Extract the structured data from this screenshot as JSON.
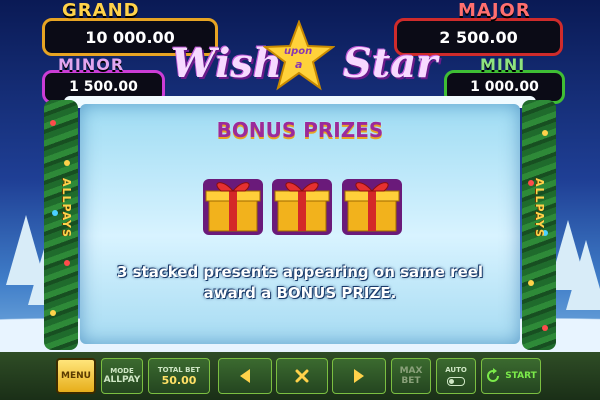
{
  "jackpots": {
    "grand": {
      "title": "GRAND",
      "value": "10 000.00",
      "color": "#e7a423"
    },
    "major": {
      "title": "MAJOR",
      "value": "2 500.00",
      "color": "#cf2b2b"
    },
    "minor": {
      "title": "MINOR",
      "value": "1 500.00",
      "color": "#cb3dd6"
    },
    "mini": {
      "title": "MINI",
      "value": "1 000.00",
      "color": "#3fbe34"
    }
  },
  "logo": {
    "word1": "Wish",
    "star_text1": "upon",
    "star_text2": "a",
    "word2": "Star"
  },
  "side_text": "ALLPAYS",
  "bonus": {
    "title": "BONUS PRIZES",
    "message_line1": "3 stacked presents appearing on same reel",
    "message_line2": "award a BONUS PRIZE."
  },
  "toolbar": {
    "menu": "MENU",
    "mode_label": "MODE",
    "mode_value": "ALLPAY",
    "total_bet_label": "TOTAL BET",
    "total_bet_value": "50.00",
    "max_bet_label1": "MAX",
    "max_bet_label2": "BET",
    "auto_label": "AUTO",
    "start": "START"
  },
  "icons": [
    "prev-arrow-icon",
    "close-x-icon",
    "next-arrow-icon",
    "auto-toggle-icon",
    "start-refresh-icon",
    "gift-icon",
    "star-icon"
  ]
}
